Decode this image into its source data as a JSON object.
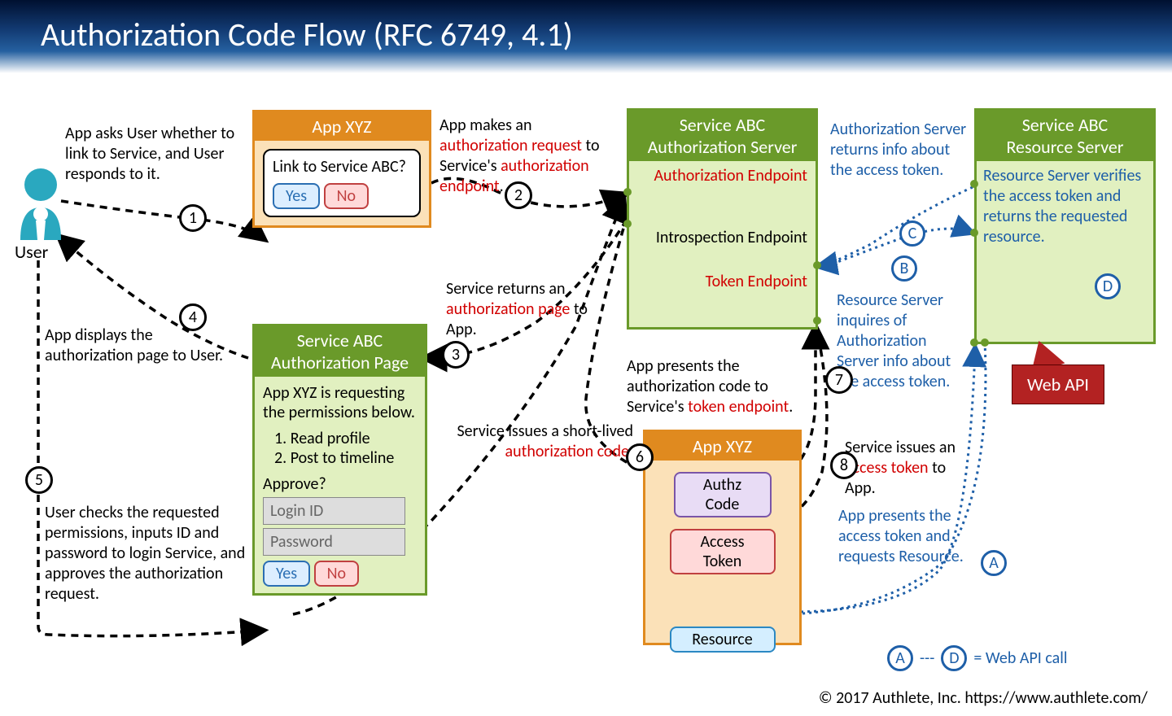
{
  "title": "Authorization Code Flow   (RFC 6749, 4.1)",
  "user_label": "User",
  "app_box1_title": "App XYZ",
  "app_dialog_question": "Link to Service ABC?",
  "btn_yes": "Yes",
  "btn_no": "No",
  "note1": "App asks User whether to link to Service, and User responds to it.",
  "note2a": "App makes an ",
  "note2b": "authorization request",
  "note2c": " to Service's ",
  "note2d": "authorization endpoint",
  "note2e": ".",
  "authserver_title1": "Service ABC",
  "authserver_title2": "Authorization Server",
  "ep_authz": "Authorization Endpoint",
  "ep_introspect": "Introspection Endpoint",
  "ep_token": "Token Endpoint",
  "noteC": "Authorization Server returns info about the access token.",
  "resserver_title1": "Service ABC",
  "resserver_title2": "Resource Server",
  "noteRS": "Resource Server verifies the access token and returns the requested resource.",
  "note3a": "Service returns an ",
  "note3b": "authorization page",
  "note3c": " to App.",
  "authpage_title1": "Service ABC",
  "authpage_title2": "Authorization Page",
  "authpage_msg": "App XYZ is requesting the permissions below.",
  "perm1": "1. Read profile",
  "perm2": "2. Post to timeline",
  "approve_q": "Approve?",
  "login_ph": "Login ID",
  "password_ph": "Password",
  "note4": "App displays the authorization page to User.",
  "note5": "User checks the requested permissions, inputs ID and password to login Service, and approves the authorization request.",
  "note6a": "Service issues a short-lived ",
  "note6b": "authorization code",
  "note6c": ".",
  "app_box2_title": "App XYZ",
  "authz_code": "Authz Code",
  "access_token": "Access Token",
  "resource": "Resource",
  "note7a": "App presents the authorization code to Service's ",
  "note7b": "token endpoint",
  "note7c": ".",
  "note8a": "Service issues an ",
  "note8b": "access token",
  "note8c": " to App.",
  "noteA": "App presents the access token and requests Resource.",
  "noteB": "Resource Server inquires of Authorization Server info about the access token.",
  "webapi": "Web API",
  "legend": " = Web API call",
  "footer": "© 2017 Authlete, Inc.  https://www.authlete.com/"
}
